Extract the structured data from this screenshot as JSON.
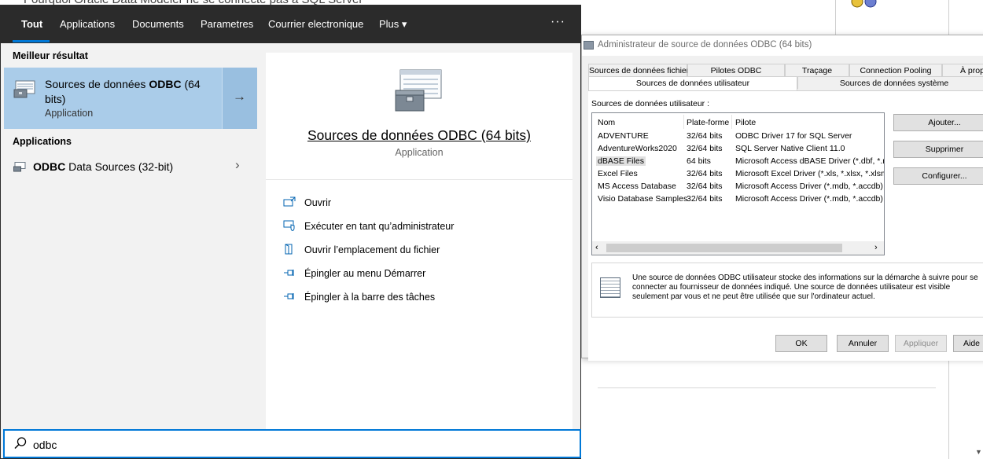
{
  "background": {
    "heading": "Pourquoi Oracle Data Modeler ne se connecte pas à SQL Server"
  },
  "odbc_dialog": {
    "title": "Administrateur de source de données ODBC (64 bits)",
    "tabs_row1": [
      "Sources de données fichier",
      "Pilotes ODBC",
      "Traçage",
      "Connection Pooling",
      "À propos"
    ],
    "tabs_row2": [
      "Sources de données utilisateur",
      "Sources de données système"
    ],
    "list_label": "Sources de données utilisateur :",
    "columns": [
      "Nom",
      "Plate-forme",
      "Pilote"
    ],
    "rows": [
      {
        "name": "ADVENTURE",
        "platform": "32/64 bits",
        "driver": "ODBC Driver 17 for SQL Server"
      },
      {
        "name": "AdventureWorks2020",
        "platform": "32/64 bits",
        "driver": "SQL Server Native Client 11.0"
      },
      {
        "name": "dBASE Files",
        "platform": "64 bits",
        "driver": "Microsoft Access dBASE Driver (*.dbf, *.ndx"
      },
      {
        "name": "Excel Files",
        "platform": "32/64 bits",
        "driver": "Microsoft Excel Driver (*.xls, *.xlsx, *.xlsm, *"
      },
      {
        "name": "MS Access Database",
        "platform": "32/64 bits",
        "driver": "Microsoft Access Driver (*.mdb, *.accdb)"
      },
      {
        "name": "Visio Database Samples",
        "platform": "32/64 bits",
        "driver": "Microsoft Access Driver (*.mdb, *.accdb)"
      }
    ],
    "selected_row": "dBASE Files",
    "buttons_side": {
      "add": "Ajouter...",
      "remove": "Supprimer",
      "configure": "Configurer..."
    },
    "info_text": "Une source de données ODBC utilisateur stocke des informations sur la démarche à suivre pour se connecter au fournisseur de données indiqué.  Une source de données utilisateur est visible seulement par vous et ne peut être utilisée que sur l'ordinateur actuel.",
    "buttons_bottom": {
      "ok": "OK",
      "cancel": "Annuler",
      "apply": "Appliquer",
      "help": "Aide"
    }
  },
  "search": {
    "nav": {
      "tout": "Tout",
      "applications": "Applications",
      "documents": "Documents",
      "parametres": "Parametres",
      "courrier": "Courrier electronique",
      "plus": "Plus ▾",
      "more": "···"
    },
    "best_match_title": "Meilleur résultat",
    "best_match": {
      "name_prefix": "Sources de données ",
      "name_bold": "ODBC",
      "name_suffix": " (64 bits)",
      "type": "Application"
    },
    "apps_title": "Applications",
    "app_result": {
      "name_bold": "ODBC",
      "name_suffix": " Data Sources (32-bit)"
    },
    "preview": {
      "title": "Sources de données ODBC (64 bits)",
      "type": "Application",
      "actions": [
        {
          "icon": "open-icon",
          "label": "Ouvrir"
        },
        {
          "icon": "run-as-admin-icon",
          "label": "Exécuter en tant qu’administrateur"
        },
        {
          "icon": "file-location-icon",
          "label": "Ouvrir l’emplacement du fichier"
        },
        {
          "icon": "pin-start-icon",
          "label": "Épingler au menu Démarrer"
        },
        {
          "icon": "pin-taskbar-icon",
          "label": "Épingler à la barre des tâches"
        }
      ]
    },
    "query": "odbc"
  },
  "colors": {
    "accent": "#0078d7",
    "nav_bg": "#2b2b2b",
    "best_match_bg": "#aacce9"
  }
}
